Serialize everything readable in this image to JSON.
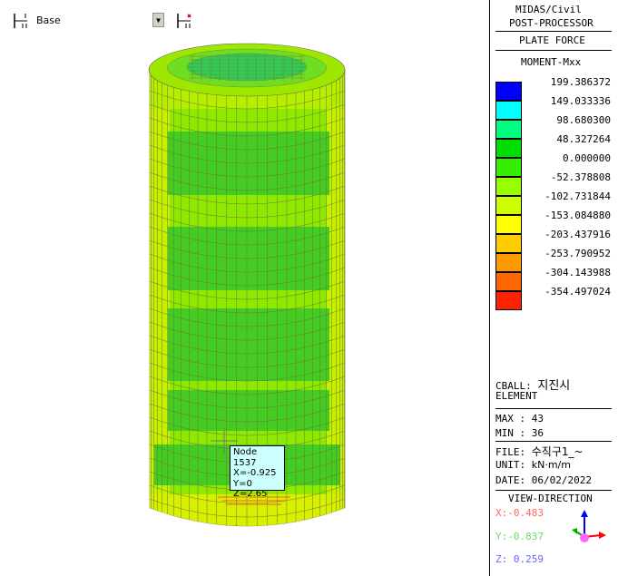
{
  "toolbar": {
    "base_label": "Base"
  },
  "tooltip": {
    "lines": [
      "Node 1537",
      "X=-0.925",
      "Y=0",
      "Z=2.65"
    ]
  },
  "panel": {
    "title1": "MIDAS/Civil",
    "title2": "POST-PROCESSOR",
    "title3": "PLATE FORCE",
    "result_type": "MOMENT-Mxx",
    "legend": [
      {
        "value": "199.386372",
        "color": "#0000ff"
      },
      {
        "value": "149.033336",
        "color": "#00ffff"
      },
      {
        "value": "98.680300",
        "color": "#00ff80"
      },
      {
        "value": "48.327264",
        "color": "#00dd00"
      },
      {
        "value": "0.000000",
        "color": "#33ee00"
      },
      {
        "value": "-52.378808",
        "color": "#99ff00"
      },
      {
        "value": "-102.731844",
        "color": "#ccff00"
      },
      {
        "value": "-153.084880",
        "color": "#ffff00"
      },
      {
        "value": "-203.437916",
        "color": "#ffcc00"
      },
      {
        "value": "-253.790952",
        "color": "#ff9900"
      },
      {
        "value": "-304.143988",
        "color": "#ff6600"
      },
      {
        "value": "-354.497024",
        "color": "#ff2200"
      }
    ],
    "cball_label": "CBALL:",
    "cball_name": "지진시",
    "element_label": "ELEMENT",
    "max_label": "MAX : 43",
    "min_label": "MIN : 36",
    "file_label": "FILE:",
    "file_name": "수직구1_~",
    "unit_label": "UNIT:",
    "unit_value": "kN·m/m",
    "date_label": "DATE: 06/02/2022",
    "view_direction": "VIEW-DIRECTION",
    "view_x": "X:-0.483",
    "view_y": "Y:-0.837",
    "view_z": "Z: 0.259",
    "colors": {
      "x_axis": "#ff0000",
      "y_axis": "#00cc00",
      "z_axis": "#0000ff"
    }
  }
}
